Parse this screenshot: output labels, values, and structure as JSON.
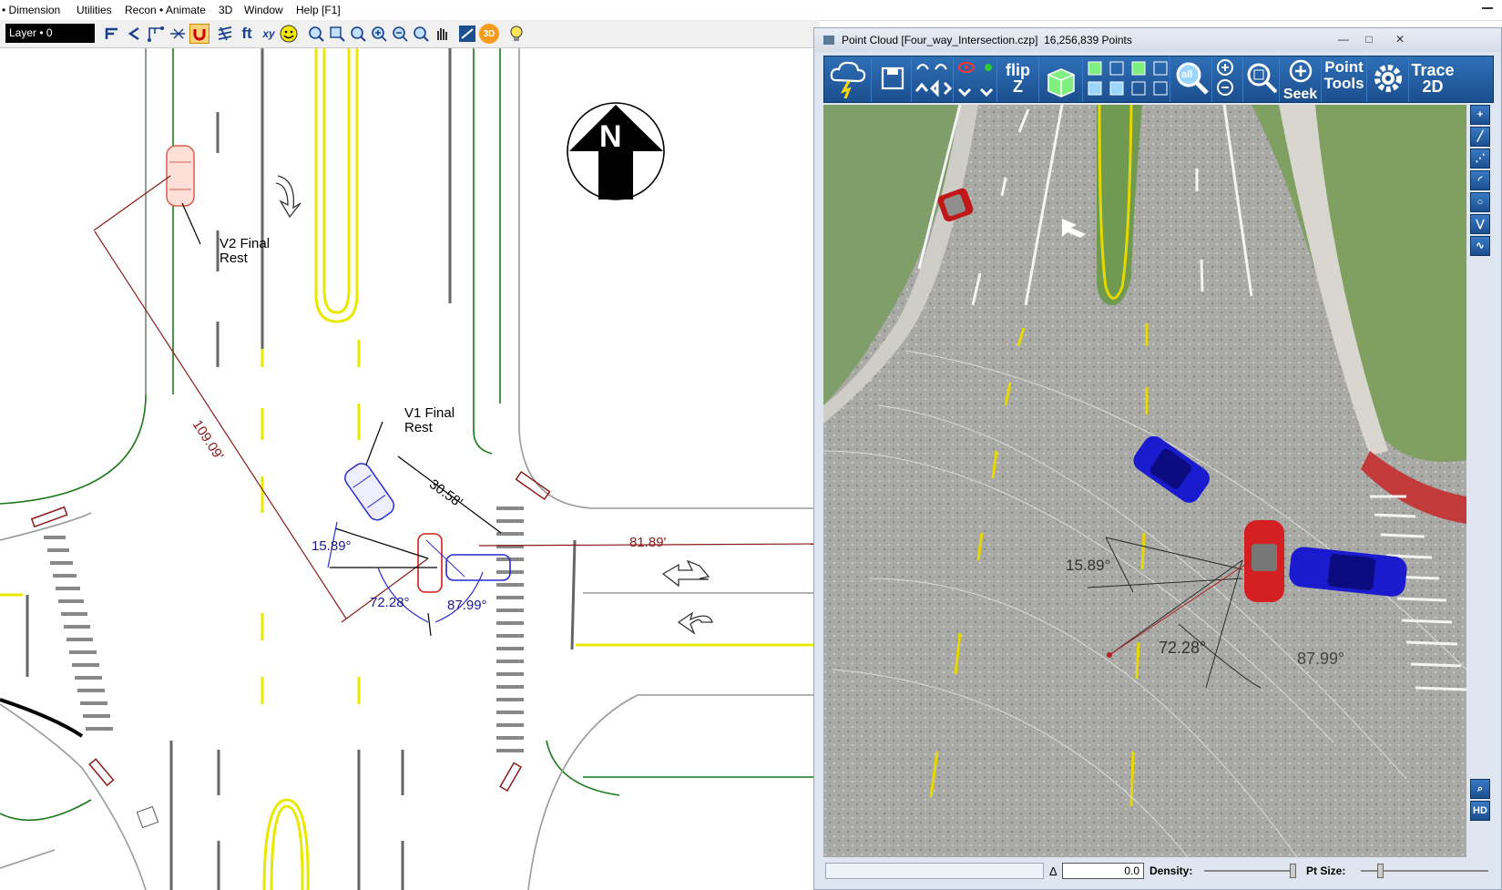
{
  "menu": {
    "items": [
      "• Dimension",
      "Utilities",
      "Recon • Animate",
      "3D",
      "Window",
      "Help [F1]"
    ]
  },
  "toolbar": {
    "layer": "Layer • 0",
    "ft_label": "ft",
    "xy_label": "xy",
    "threed_label": "3D"
  },
  "cad": {
    "v2_label_line1": "V2 Final",
    "v2_label_line2": "Rest",
    "v1_label_line1": "V1 Final",
    "v1_label_line2": "Rest",
    "north_letter": "N",
    "dim_long": "109.09'",
    "dim_v1": "30.58'",
    "dim_east": "81.89'",
    "angle_a": "15.89°",
    "angle_b": "72.28°",
    "angle_c": "87.99°"
  },
  "point_cloud": {
    "title_name": "Point Cloud [Four_way_Intersection.czp]",
    "title_points": "16,256,839 Points",
    "buttons": {
      "flip_line1": "flip",
      "flip_line2": "Z",
      "all": "all",
      "seek": "Seek",
      "point_tools_line1": "Point",
      "point_tools_line2": "Tools",
      "trace_line1": "Trace",
      "trace_line2": "2D"
    },
    "side_hd": "HD",
    "view_angle_a": "15.89°",
    "view_angle_b": "72.28°",
    "view_angle_c": "87.99°",
    "status": {
      "delta_symbol": "Δ",
      "delta_value": "0.0",
      "density_label": "Density:",
      "ptsize_label": "Pt Size:"
    }
  },
  "colors": {
    "pc_toolbar": "#1b4f8f",
    "vehicle_red": "#d42020",
    "vehicle_blue": "#1a1acf",
    "dimension": "#8b1a1a",
    "curb": "#1a7a1a",
    "lane_yellow": "#e8e800"
  }
}
